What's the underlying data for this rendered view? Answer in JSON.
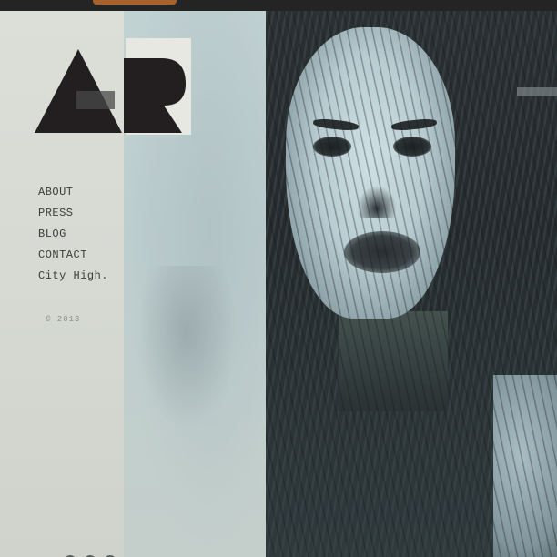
{
  "logo": {
    "text": "AR",
    "primary_color": "#231f20",
    "accent_color": "#e8e8e2"
  },
  "nav": {
    "items": [
      {
        "label": "ABOUT"
      },
      {
        "label": "PRESS"
      },
      {
        "label": "BLOG"
      },
      {
        "label": "CONTACT"
      },
      {
        "label": "City High."
      }
    ]
  },
  "footer": {
    "copyright": "© 2013"
  },
  "social": {
    "icons": [
      "twitter-icon",
      "facebook-icon",
      "tumblr-icon"
    ]
  },
  "hero": {
    "image": "portrait-photo"
  }
}
